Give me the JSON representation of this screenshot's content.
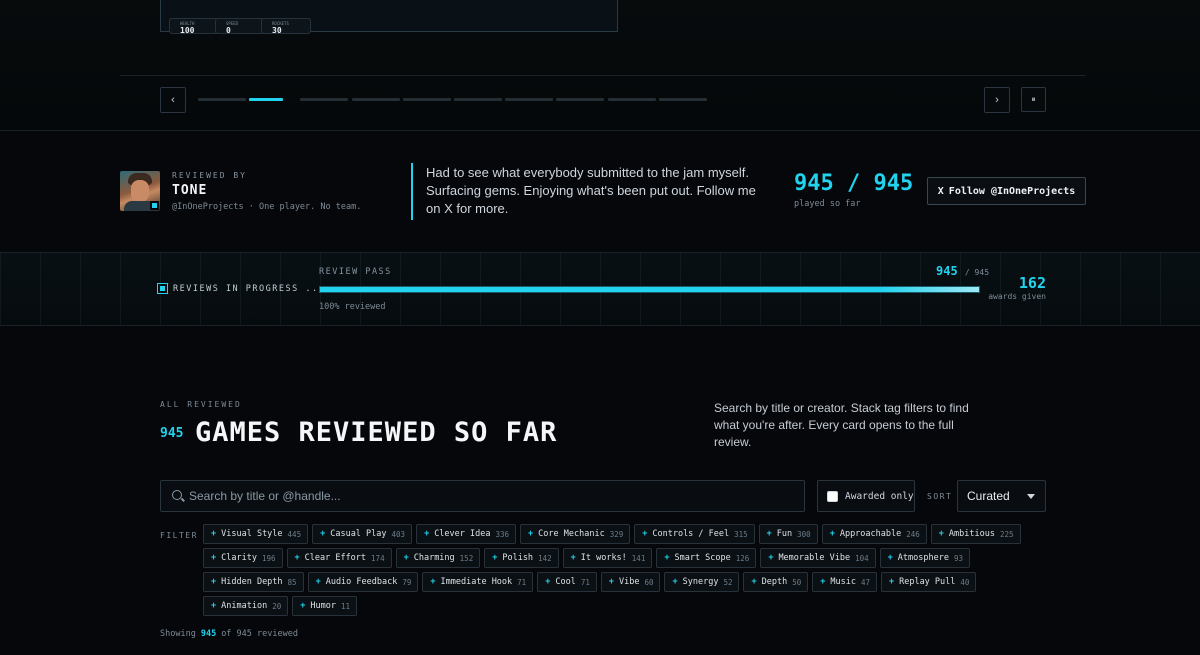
{
  "carousel": {
    "stats": [
      {
        "label": "HEALTH",
        "value": "100"
      },
      {
        "label": "SPEED",
        "value": "0"
      },
      {
        "label": "ROCKETS",
        "value": "30"
      }
    ],
    "prev_icon": "‹",
    "next_icon": "›",
    "pause_icon": "⏸",
    "slide_count": 10,
    "active_slide": 2
  },
  "reviewer": {
    "by_label": "REVIEWED BY",
    "name": "TONE",
    "handle_line": "@InOneProjects · One player. No team.",
    "quote": "Had to see what everybody submitted to the jam myself. Surfacing gems. Enjoying what's been put out. Follow me on X for more.",
    "played": "945 / 945",
    "played_label": "played so far",
    "follow_icon": "X",
    "follow_label": "Follow @InOneProjects"
  },
  "progress": {
    "status_label": "REVIEWS IN PROGRESS ...",
    "pass_label": "REVIEW PASS",
    "count": "945",
    "total": "/ 945",
    "fraction": 1.0,
    "percent_label": "100% reviewed",
    "awards_count": "162",
    "awards_label": "awards given"
  },
  "catalog": {
    "eyebrow": "ALL REVIEWED",
    "count": "945",
    "title": "GAMES REVIEWED SO FAR",
    "description": "Search by title or creator. Stack tag filters to find what you're after. Every card opens to the full review.",
    "search_placeholder": "Search by title or @handle...",
    "awarded_label": "Awarded only",
    "sort_label": "SORT",
    "sort_value": "Curated",
    "filter_label": "FILTER",
    "tags": [
      {
        "name": "Visual Style",
        "count": "445"
      },
      {
        "name": "Casual Play",
        "count": "403"
      },
      {
        "name": "Clever Idea",
        "count": "336"
      },
      {
        "name": "Core Mechanic",
        "count": "329"
      },
      {
        "name": "Controls / Feel",
        "count": "315"
      },
      {
        "name": "Fun",
        "count": "300"
      },
      {
        "name": "Approachable",
        "count": "246"
      },
      {
        "name": "Ambitious",
        "count": "225"
      },
      {
        "name": "Clarity",
        "count": "196"
      },
      {
        "name": "Clear Effort",
        "count": "174"
      },
      {
        "name": "Charming",
        "count": "152"
      },
      {
        "name": "Polish",
        "count": "142"
      },
      {
        "name": "It works!",
        "count": "141"
      },
      {
        "name": "Smart Scope",
        "count": "126"
      },
      {
        "name": "Memorable Vibe",
        "count": "104"
      },
      {
        "name": "Atmosphere",
        "count": "93"
      },
      {
        "name": "Hidden Depth",
        "count": "85"
      },
      {
        "name": "Audio Feedback",
        "count": "79"
      },
      {
        "name": "Immediate Hook",
        "count": "71"
      },
      {
        "name": "Cool",
        "count": "71"
      },
      {
        "name": "Vibe",
        "count": "60"
      },
      {
        "name": "Synergy",
        "count": "52"
      },
      {
        "name": "Depth",
        "count": "50"
      },
      {
        "name": "Music",
        "count": "47"
      },
      {
        "name": "Replay Pull",
        "count": "40"
      },
      {
        "name": "Animation",
        "count": "20"
      },
      {
        "name": "Humor",
        "count": "11"
      }
    ],
    "showing_prefix": "Showing",
    "showing_count": "945",
    "showing_suffix": "of 945 reviewed"
  },
  "colors": {
    "accent": "#22d3ee",
    "background": "#05070b"
  }
}
